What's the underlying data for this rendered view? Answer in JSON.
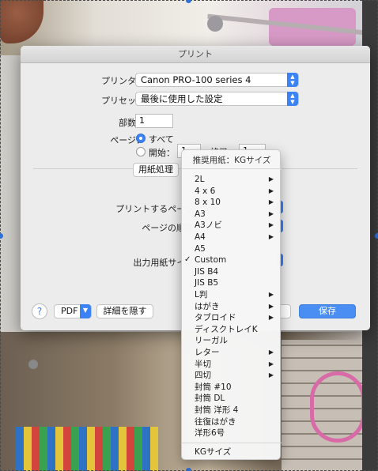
{
  "dialog": {
    "title": "プリント",
    "printer_label": "プリンタ：",
    "printer_value": "Canon PRO-100 series 4",
    "preset_label": "プリセット",
    "preset_value": "最後に使用した設定",
    "copies_label": "部数：",
    "copies_value": "1",
    "pages_label": "ページ：",
    "pages_all": "すべて",
    "pages_from": "開始：",
    "pages_from_value": "1",
    "pages_to": "終了：",
    "pages_to_value": "1",
    "paper_handling": "用紙処理",
    "pages_to_print_label": "プリントするページ：",
    "page_order_label": "ページの順序：",
    "output_paper_size_label": "出力用紙サイズ：",
    "help": "?",
    "pdf": "PDF",
    "hide_details": "詳細を隠す",
    "save": "保存"
  },
  "menu": {
    "header": "推奨用紙：KGサイズ",
    "items": [
      {
        "label": "2L",
        "submenu": true
      },
      {
        "label": "4 x 6",
        "submenu": true
      },
      {
        "label": "8 x 10",
        "submenu": true
      },
      {
        "label": "A3",
        "submenu": true
      },
      {
        "label": "A3ノビ",
        "submenu": true
      },
      {
        "label": "A4",
        "submenu": true
      },
      {
        "label": "A5",
        "submenu": false
      },
      {
        "label": "Custom",
        "submenu": false,
        "checked": true
      },
      {
        "label": "JIS B4",
        "submenu": false
      },
      {
        "label": "JIS B5",
        "submenu": false
      },
      {
        "label": "L判",
        "submenu": true
      },
      {
        "label": "はがき",
        "submenu": true
      },
      {
        "label": "タブロイド",
        "submenu": true
      },
      {
        "label": "ディスクトレイK",
        "submenu": false
      },
      {
        "label": "リーガル",
        "submenu": false
      },
      {
        "label": "レター",
        "submenu": true
      },
      {
        "label": "半切",
        "submenu": true
      },
      {
        "label": "四切",
        "submenu": true
      },
      {
        "label": "封筒 #10",
        "submenu": false
      },
      {
        "label": "封筒 DL",
        "submenu": false
      },
      {
        "label": "封筒 洋形 4",
        "submenu": false
      },
      {
        "label": "往復はがき",
        "submenu": false
      },
      {
        "label": "洋形6号",
        "submenu": false
      }
    ],
    "footer": "KGサイズ",
    "check_mark": "✓",
    "submenu_arrow": "▶"
  },
  "colors": {
    "accent": "#3b82f6",
    "dialog_bg": "#ececec"
  }
}
